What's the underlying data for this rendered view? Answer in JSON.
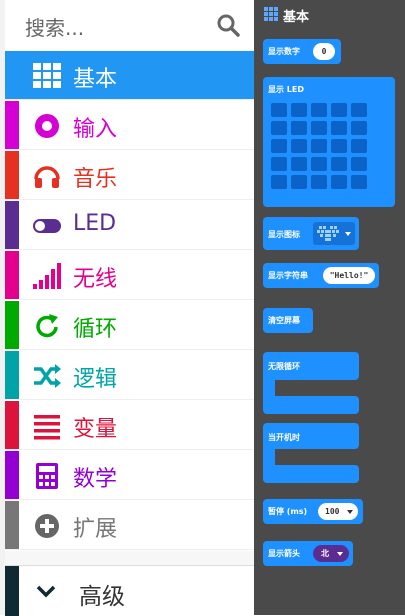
{
  "search": {
    "placeholder": "搜索..."
  },
  "categories": [
    {
      "label": "基本",
      "color": "#2196f3",
      "icon": "grid-icon",
      "selected": true
    },
    {
      "label": "输入",
      "color": "#d400d4",
      "icon": "circle-target-icon"
    },
    {
      "label": "音乐",
      "color": "#e63022",
      "icon": "headphones-icon"
    },
    {
      "label": "LED",
      "color": "#5c2d91",
      "icon": "toggle-icon"
    },
    {
      "label": "无线",
      "color": "#e3008c",
      "icon": "signal-bars-icon"
    },
    {
      "label": "循环",
      "color": "#00aa00",
      "icon": "refresh-icon"
    },
    {
      "label": "逻辑",
      "color": "#00a4a6",
      "icon": "shuffle-icon"
    },
    {
      "label": "变量",
      "color": "#dc143c",
      "icon": "list-lines-icon"
    },
    {
      "label": "数学",
      "color": "#9400d3",
      "icon": "calculator-icon"
    },
    {
      "label": "扩展",
      "color": "#777777",
      "icon": "plus-circle-icon"
    }
  ],
  "advanced": {
    "label": "高级",
    "icon": "chevron-down-icon"
  },
  "flyout": {
    "title": "基本",
    "blocks": {
      "show_number": {
        "label": "显示数字",
        "value": "0"
      },
      "show_leds": {
        "label": "显示 LED"
      },
      "show_icon": {
        "label": "显示图标"
      },
      "show_string": {
        "label": "显示字符串",
        "value": "\"Hello!\""
      },
      "clear_screen": {
        "label": "清空屏幕"
      },
      "forever": {
        "label": "无限循环"
      },
      "on_start": {
        "label": "当开机时"
      },
      "pause": {
        "label": "暂停 (ms)",
        "value": "100"
      },
      "show_arrow": {
        "label": "显示箭头",
        "value": "北"
      }
    }
  }
}
